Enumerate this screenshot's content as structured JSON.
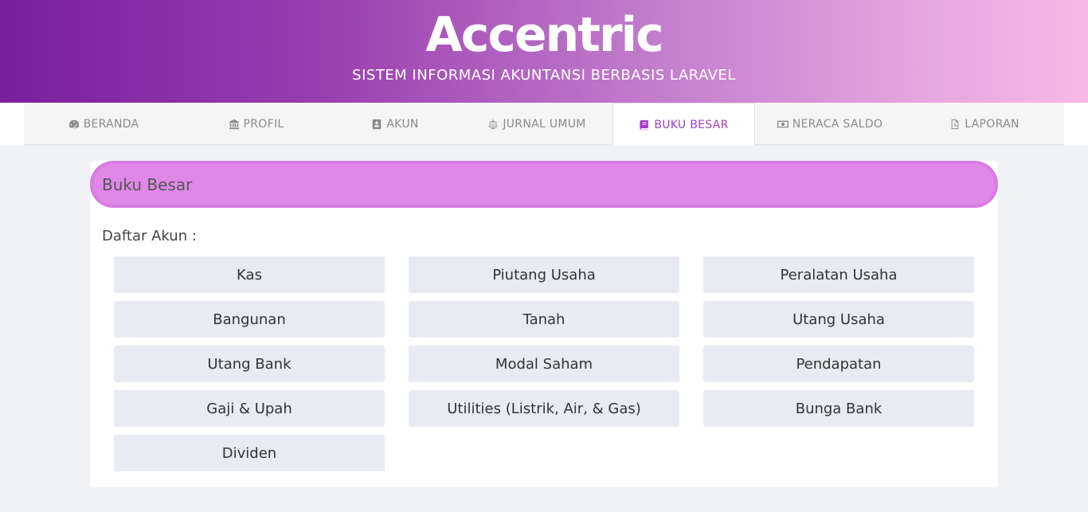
{
  "header": {
    "title": "Accentric",
    "subtitle": "SISTEM INFORMASI AKUNTANSI BERBASIS LARAVEL"
  },
  "nav": {
    "items": [
      {
        "label": "BERANDA",
        "icon": "dashboard-icon"
      },
      {
        "label": "PROFIL",
        "icon": "bank-icon"
      },
      {
        "label": "AKUN",
        "icon": "contact-book-icon"
      },
      {
        "label": "JURNAL UMUM",
        "icon": "balance-scale-icon"
      },
      {
        "label": "BUKU BESAR",
        "icon": "book-icon",
        "active": true
      },
      {
        "label": "NERACA SALDO",
        "icon": "money-icon"
      },
      {
        "label": "LAPORAN",
        "icon": "pdf-file-icon"
      }
    ],
    "active_color": "#a23fc9"
  },
  "main": {
    "card_title": "Buku Besar",
    "list_label": "Daftar Akun :",
    "accounts": [
      "Kas",
      "Piutang Usaha",
      "Peralatan Usaha",
      "Bangunan",
      "Tanah",
      "Utang Usaha",
      "Utang Bank",
      "Modal Saham",
      "Pendapatan",
      "Gaji & Upah",
      "Utilities (Listrik, Air, & Gas)",
      "Bunga Bank",
      "Dividen"
    ]
  },
  "colors": {
    "header_gradient_start": "#7a1f9c",
    "header_gradient_end": "#f7b9e4",
    "card_header": "#df88e8",
    "button_bg": "#e8ebf1"
  }
}
